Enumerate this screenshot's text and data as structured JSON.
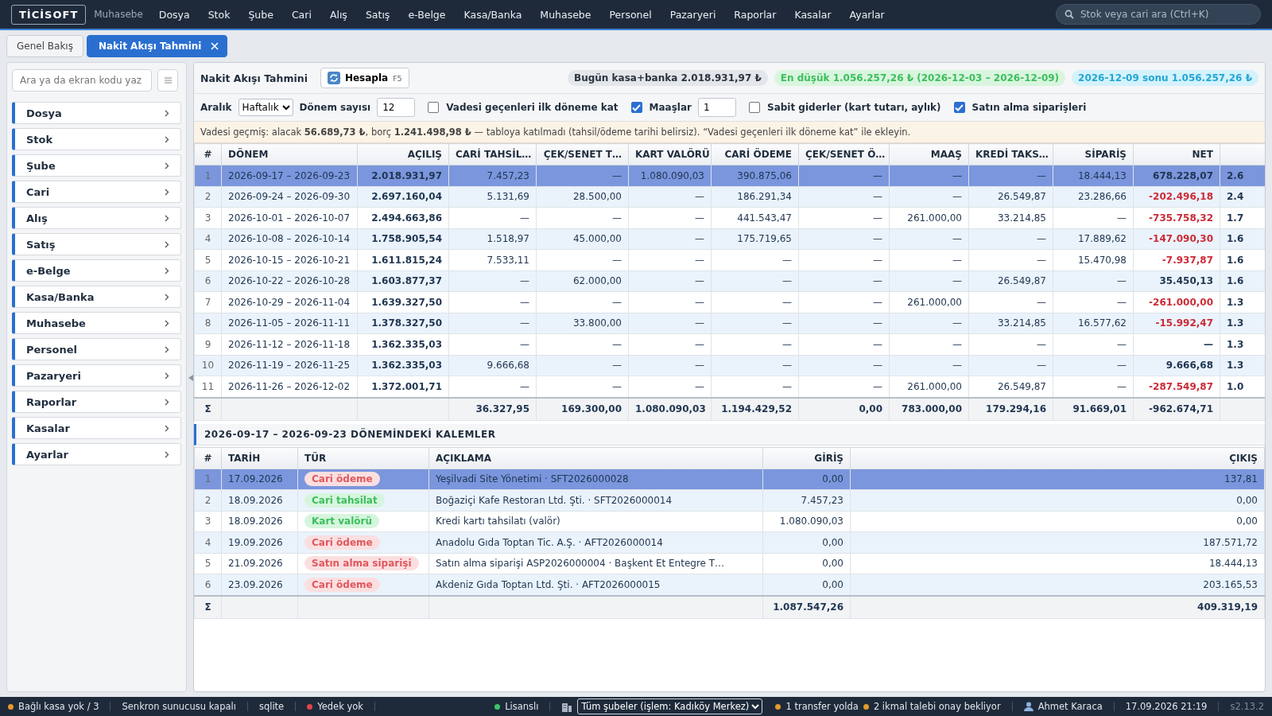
{
  "app": {
    "logo": "TİCİSOFT",
    "module": "Muhasebe"
  },
  "menu": [
    "Dosya",
    "Stok",
    "Şube",
    "Cari",
    "Alış",
    "Satış",
    "e-Belge",
    "Kasa/Banka",
    "Muhasebe",
    "Personel",
    "Pazaryeri",
    "Raporlar",
    "Kasalar",
    "Ayarlar"
  ],
  "global_search": {
    "placeholder": "Stok veya cari ara (Ctrl+K)"
  },
  "tabs": [
    {
      "label": "Genel Bakış",
      "selected": false,
      "closable": false
    },
    {
      "label": "Nakit Akışı Tahmini",
      "selected": true,
      "closable": true
    }
  ],
  "sidebar": {
    "search": {
      "placeholder": "Ara ya da ekran kodu yaz"
    },
    "items": [
      "Dosya",
      "Stok",
      "Şube",
      "Cari",
      "Alış",
      "Satış",
      "e-Belge",
      "Kasa/Banka",
      "Muhasebe",
      "Personel",
      "Pazaryeri",
      "Raporlar",
      "Kasalar",
      "Ayarlar"
    ]
  },
  "toolbar": {
    "title": "Nakit Akışı Tahmini",
    "button": {
      "label": "Hesapla",
      "shortcut": "F5"
    },
    "pills": [
      {
        "text": "Bugün kasa+banka 2.018.931,97 ₺",
        "kind": "neutral"
      },
      {
        "text": "En düşük 1.056.257,26 ₺ (2026-12-03 – 2026-12-09)",
        "kind": "good"
      },
      {
        "text": "2026-12-09 sonu 1.056.257,26 ₺",
        "kind": "info"
      }
    ]
  },
  "options": [
    {
      "kind": "select",
      "label": "Aralık",
      "value": "Haftalık"
    },
    {
      "kind": "number",
      "label": "Dönem sayısı",
      "value": "12"
    },
    {
      "kind": "checkbox",
      "label": "Vadesi geçenleri ilk döneme kat",
      "checked": false
    },
    {
      "kind": "checkbox",
      "label": "Maaşlar",
      "checked": true
    },
    {
      "kind": "number",
      "value": "1"
    },
    {
      "kind": "checkbox",
      "label": "Sabit giderler (kart tutarı, aylık)",
      "checked": false
    },
    {
      "kind": "checkbox",
      "label": "Satın alma siparişleri",
      "checked": true
    }
  ],
  "notice": "Vadesi geçmiş: alacak **56.689,73 ₺**, borç **1.241.498,98 ₺** — tabloya katılmadı (tahsil/ödeme tarihi belirsiz). “Vadesi geçenleri ilk döneme kat” ile ekleyin.",
  "table": {
    "columns": [
      "#",
      "DÖNEM",
      "AÇILIŞ",
      "CARİ TAHSİL…",
      "ÇEK/SENET T…",
      "KART VALÖRÜ",
      "CARİ ÖDEME",
      "ÇEK/SENET Ö…",
      "MAAŞ",
      "KREDİ TAKS…",
      "SİPARİŞ",
      "NET"
    ],
    "rows": [
      {
        "selected": true,
        "negative": false,
        "cells": [
          "1",
          "2026-09-17 – 2026-09-23",
          "2.018.931,97",
          "7.457,23",
          "—",
          "1.080.090,03",
          "390.875,06",
          "—",
          "—",
          "—",
          "18.444,13",
          "678.228,07",
          "2.6"
        ]
      },
      {
        "selected": false,
        "negative": true,
        "cells": [
          "2",
          "2026-09-24 – 2026-09-30",
          "2.697.160,04",
          "5.131,69",
          "28.500,00",
          "—",
          "186.291,34",
          "—",
          "—",
          "26.549,87",
          "23.286,66",
          "-202.496,18",
          "2.4"
        ]
      },
      {
        "selected": false,
        "negative": true,
        "cells": [
          "3",
          "2026-10-01 – 2026-10-07",
          "2.494.663,86",
          "—",
          "—",
          "—",
          "441.543,47",
          "—",
          "261.000,00",
          "33.214,85",
          "—",
          "-735.758,32",
          "1.7"
        ]
      },
      {
        "selected": false,
        "negative": true,
        "cells": [
          "4",
          "2026-10-08 – 2026-10-14",
          "1.758.905,54",
          "1.518,97",
          "45.000,00",
          "—",
          "175.719,65",
          "—",
          "—",
          "—",
          "17.889,62",
          "-147.090,30",
          "1.6"
        ]
      },
      {
        "selected": false,
        "negative": true,
        "cells": [
          "5",
          "2026-10-15 – 2026-10-21",
          "1.611.815,24",
          "7.533,11",
          "—",
          "—",
          "—",
          "—",
          "—",
          "—",
          "15.470,98",
          "-7.937,87",
          "1.6"
        ]
      },
      {
        "selected": false,
        "negative": false,
        "cells": [
          "6",
          "2026-10-22 – 2026-10-28",
          "1.603.877,37",
          "—",
          "62.000,00",
          "—",
          "—",
          "—",
          "—",
          "26.549,87",
          "—",
          "35.450,13",
          "1.6"
        ]
      },
      {
        "selected": false,
        "negative": true,
        "cells": [
          "7",
          "2026-10-29 – 2026-11-04",
          "1.639.327,50",
          "—",
          "—",
          "—",
          "—",
          "—",
          "261.000,00",
          "—",
          "—",
          "-261.000,00",
          "1.3"
        ]
      },
      {
        "selected": false,
        "negative": true,
        "cells": [
          "8",
          "2026-11-05 – 2026-11-11",
          "1.378.327,50",
          "—",
          "33.800,00",
          "—",
          "—",
          "—",
          "—",
          "33.214,85",
          "16.577,62",
          "-15.992,47",
          "1.3"
        ]
      },
      {
        "selected": false,
        "negative": false,
        "cells": [
          "9",
          "2026-11-12 – 2026-11-18",
          "1.362.335,03",
          "—",
          "—",
          "—",
          "—",
          "—",
          "—",
          "—",
          "—",
          "—",
          "1.3"
        ]
      },
      {
        "selected": false,
        "negative": false,
        "cells": [
          "10",
          "2026-11-19 – 2026-11-25",
          "1.362.335,03",
          "9.666,68",
          "—",
          "—",
          "—",
          "—",
          "—",
          "—",
          "—",
          "9.666,68",
          "1.3"
        ]
      },
      {
        "selected": false,
        "negative": true,
        "cells": [
          "11",
          "2026-11-26 – 2026-12-02",
          "1.372.001,71",
          "—",
          "—",
          "—",
          "—",
          "—",
          "261.000,00",
          "26.549,87",
          "—",
          "-287.549,87",
          "1.0"
        ]
      }
    ],
    "totals": {
      "label": "Σ",
      "values": [
        "36.327,95",
        "169.300,00",
        "1.080.090,03",
        "1.194.429,52",
        "0,00",
        "783.000,00",
        "179.294,16",
        "91.669,01",
        "-962.674,71"
      ]
    }
  },
  "detail": {
    "title": "2026-09-17 – 2026-09-23 DÖNEMİNDEKİ KALEMLER",
    "columns": [
      "#",
      "TARİH",
      "TÜR",
      "AÇIKLAMA",
      "GİRİŞ",
      "ÇIKIŞ"
    ],
    "rows": [
      {
        "selected": true,
        "no": "1",
        "date": "17.09.2026",
        "type": {
          "label": "Cari ödeme",
          "kind": "out"
        },
        "description": "Yeşilvadi Site Yönetimi · SFT2026000028",
        "in": "0,00",
        "out": "137,81"
      },
      {
        "selected": false,
        "no": "2",
        "date": "18.09.2026",
        "type": {
          "label": "Cari tahsilat",
          "kind": "in"
        },
        "description": "Boğaziçi Kafe Restoran Ltd. Şti. · SFT2026000014",
        "in": "7.457,23",
        "out": "0,00"
      },
      {
        "selected": false,
        "no": "3",
        "date": "18.09.2026",
        "type": {
          "label": "Kart valörü",
          "kind": "in"
        },
        "description": "Kredi kartı tahsilatı (valör)",
        "in": "1.080.090,03",
        "out": "0,00"
      },
      {
        "selected": false,
        "no": "4",
        "date": "19.09.2026",
        "type": {
          "label": "Cari ödeme",
          "kind": "out"
        },
        "description": "Anadolu Gıda Toptan Tic. A.Ş. · AFT2026000014",
        "in": "0,00",
        "out": "187.571,72"
      },
      {
        "selected": false,
        "no": "5",
        "date": "21.09.2026",
        "type": {
          "label": "Satın alma siparişi",
          "kind": "out"
        },
        "description": "Satın alma siparişi ASP2026000004 · Başkent Et Entegre T…",
        "in": "0,00",
        "out": "18.444,13"
      },
      {
        "selected": false,
        "no": "6",
        "date": "23.09.2026",
        "type": {
          "label": "Cari ödeme",
          "kind": "out"
        },
        "description": "Akdeniz Gıda Toptan Ltd. Şti. · AFT2026000015",
        "in": "0,00",
        "out": "203.165,53"
      }
    ],
    "totals": {
      "label": "Σ",
      "in": "1.087.547,26",
      "out": "409.319,19"
    }
  },
  "status_left": [
    {
      "text": "Bağlı kasa yok / 3",
      "color": "#e39a2b"
    },
    {
      "text": "Senkron sunucusu kapalı"
    },
    {
      "text": "sqlite"
    },
    {
      "text": "Yedek yok",
      "color": "#e0454f"
    }
  ],
  "status_right": {
    "license": {
      "text": "Lisanslı",
      "color": "#3cc46a"
    },
    "branch": "Tüm şubeler (işlem: Kadıköy Merkez)",
    "alerts": [
      {
        "text": "1 transfer yolda",
        "color": "#e39a2b"
      },
      {
        "text": "2 ikmal talebi onay bekliyor",
        "color": "#e39a2b"
      }
    ],
    "user": "Ahmet Karaca",
    "datetime": "17.09.2026 21:19",
    "version": "s2.13.2"
  }
}
